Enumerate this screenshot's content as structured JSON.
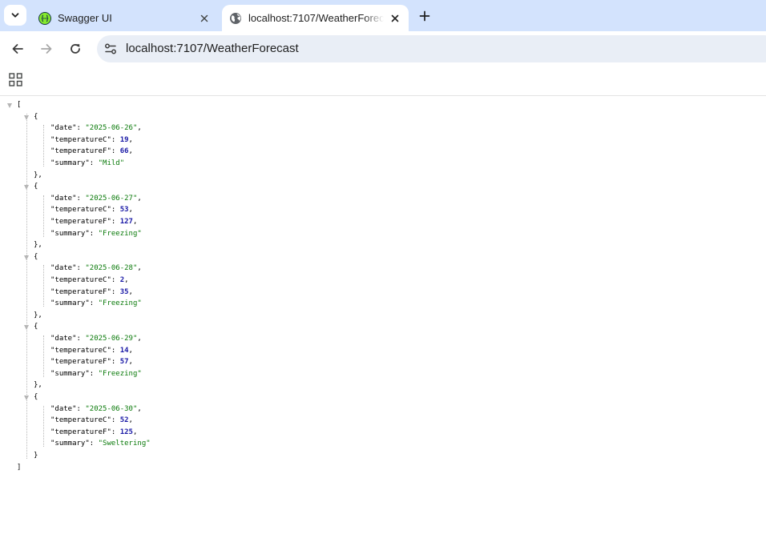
{
  "browser": {
    "tabs": [
      {
        "title": "Swagger UI",
        "favicon": "swagger-icon",
        "active": false
      },
      {
        "title": "localhost:7107/WeatherForecast",
        "favicon": "globe-icon",
        "active": true
      }
    ],
    "address_bar": {
      "url": "localhost:7107/WeatherForecast",
      "site_info_icon": "tune-icon"
    },
    "toolbar_icons": [
      "back-icon",
      "forward-icon",
      "reload-icon"
    ],
    "colors": {
      "tabstrip": "#d3e3fd",
      "omnibox": "#e9eef6",
      "json_string": "#0a7a0a",
      "json_number": "#1a1aa6"
    }
  },
  "json": {
    "open_bracket": "[",
    "close_bracket": "]",
    "items": [
      {
        "date": "2025-06-26",
        "temperatureC": 19,
        "temperatureF": 66,
        "summary": "Mild"
      },
      {
        "date": "2025-06-27",
        "temperatureC": 53,
        "temperatureF": 127,
        "summary": "Freezing"
      },
      {
        "date": "2025-06-28",
        "temperatureC": 2,
        "temperatureF": 35,
        "summary": "Freezing"
      },
      {
        "date": "2025-06-29",
        "temperatureC": 14,
        "temperatureF": 57,
        "summary": "Freezing"
      },
      {
        "date": "2025-06-30",
        "temperatureC": 52,
        "temperatureF": 125,
        "summary": "Sweltering"
      }
    ]
  }
}
